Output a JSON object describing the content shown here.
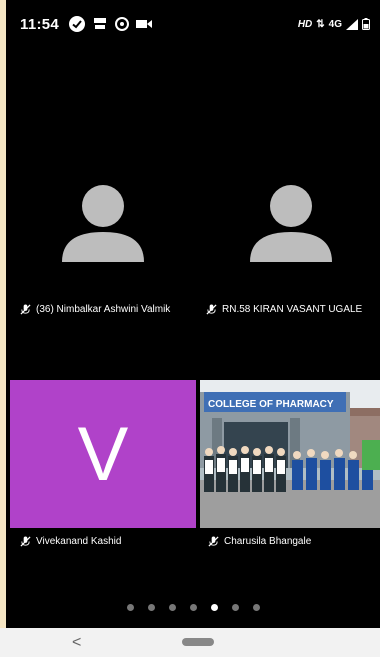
{
  "status_bar": {
    "time": "11:54",
    "network": "HD",
    "signal_text": "4G"
  },
  "participants": [
    {
      "name": "(36) Nimbalkar Ashwini Valmik",
      "muted": true,
      "avatar": "person-silhouette"
    },
    {
      "name": "RN.58 KIRAN VASANT UGALE",
      "muted": true,
      "avatar": "person-silhouette"
    },
    {
      "name": "Vivekanand Kashid",
      "muted": true,
      "avatar_letter": "V",
      "avatar_color": "#b042c9"
    },
    {
      "name": "Charusila Bhangale",
      "muted": true,
      "avatar": "video-feed",
      "sign_text": "COLLEGE OF PHARMACY"
    }
  ],
  "pager": {
    "pages": 7,
    "active_index": 4
  },
  "nav": {
    "back": "<"
  }
}
